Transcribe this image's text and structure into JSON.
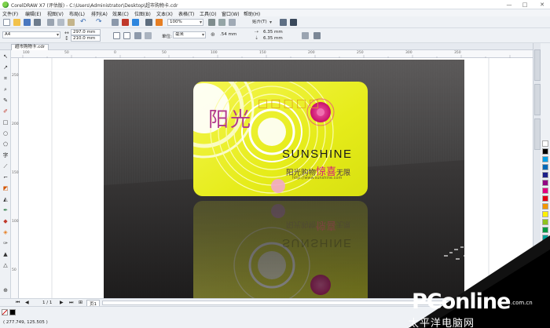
{
  "title_bar": {
    "title": "CorelDRAW X7 (评估版) - C:\\Users\\Administrator\\Desktop\\超市购物卡.cdr",
    "minimize": "—",
    "maximize": "□",
    "close": "✕"
  },
  "menu": [
    {
      "label": "文件(F)"
    },
    {
      "label": "编辑(E)"
    },
    {
      "label": "视图(V)"
    },
    {
      "label": "布局(L)"
    },
    {
      "label": "排列(A)"
    },
    {
      "label": "效果(C)"
    },
    {
      "label": "位图(B)"
    },
    {
      "label": "文本(X)"
    },
    {
      "label": "表格(T)"
    },
    {
      "label": "工具(O)"
    },
    {
      "label": "窗口(W)"
    },
    {
      "label": "帮助(H)"
    }
  ],
  "standard_toolbar": {
    "zoom": "100%",
    "snap_to": "贴齐(T)"
  },
  "property_bar": {
    "page_size": "A4",
    "width": "297.0 mm",
    "height": "210.0 mm",
    "units_label": "单位:",
    "units": "毫米",
    "nudge": ".54 mm",
    "dup_x": "6.35 mm",
    "dup_y": "6.35 mm"
  },
  "document_tab": {
    "label": "超市购物卡.cdr"
  },
  "ruler": {
    "top_numbers": [
      "100",
      "50",
      "0",
      "50",
      "100",
      "150",
      "200",
      "250",
      "300",
      "350"
    ],
    "left_numbers": [
      "250",
      "200",
      "150",
      "100",
      "50"
    ]
  },
  "card": {
    "title_cn": "阳光",
    "title_boxes": [
      "□",
      "□",
      "□",
      "□",
      "□"
    ],
    "brand": "SUNSHINE",
    "slogan_a": "阳光购物",
    "slogan_b": "惊喜",
    "slogan_c": "无限",
    "url": "http://www.sunshine.com",
    "card_color": "#e6ec1a",
    "accent_color": "#d8167a"
  },
  "page_nav": {
    "page_count": "1 / 1",
    "page_tab": "页1"
  },
  "status": {
    "coordinates": "( 277.749, 125.505 )"
  },
  "palette": [
    "#ffffff",
    "#000000",
    "#00a0e9",
    "#0068b7",
    "#1d2088",
    "#920783",
    "#e4007f",
    "#e60012",
    "#f39800",
    "#fff100",
    "#8fc31f",
    "#009944",
    "#00a29a",
    "#c9a2cb",
    "#a0a0a0"
  ],
  "watermark": {
    "brand": "PConline",
    "suffix": ".com.cn",
    "sub": "太平洋电脑网"
  }
}
